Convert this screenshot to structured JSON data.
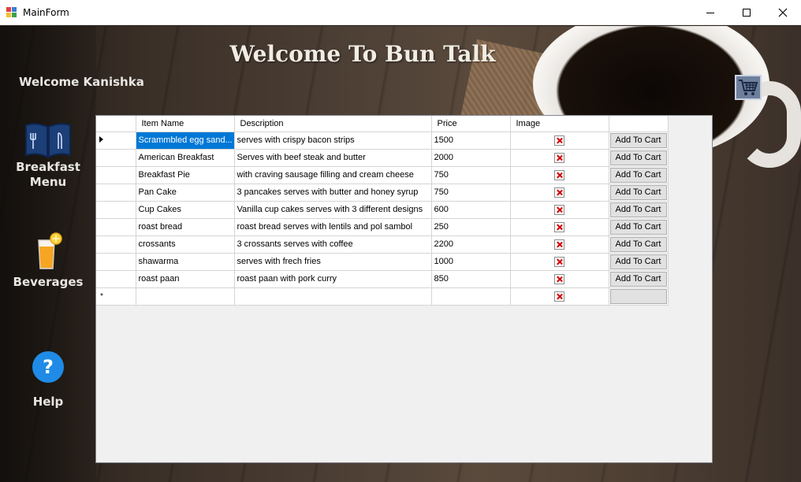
{
  "window": {
    "title": "MainForm"
  },
  "header": {
    "welcome_title": "Welcome To Bun Talk",
    "welcome_user": "Welcome Kanishka"
  },
  "sidebar": {
    "items": [
      {
        "label": "Breakfast\nMenu",
        "icon": "menu-book-icon"
      },
      {
        "label": "Beverages",
        "icon": "juice-glass-icon"
      },
      {
        "label": "Help",
        "icon": "help-icon"
      }
    ]
  },
  "cart": {
    "icon": "shopping-cart-icon"
  },
  "grid": {
    "columns": [
      "Item Name",
      "Description",
      "Price",
      "Image",
      ""
    ],
    "button_label": "Add To Cart",
    "rows": [
      {
        "name": "Scrammbled egg sand...",
        "description": "serves with crispy bacon strips",
        "price": "1500"
      },
      {
        "name": "American Breakfast",
        "description": "Serves with beef steak and butter",
        "price": "2000"
      },
      {
        "name": "Breakfast Pie",
        "description": "with craving sausage filling and cream cheese",
        "price": "750"
      },
      {
        "name": "Pan Cake",
        "description": "3 pancakes serves with butter and honey syrup",
        "price": "750"
      },
      {
        "name": "Cup Cakes",
        "description": "Vanilla cup cakes serves with 3 different designs",
        "price": "600"
      },
      {
        "name": "roast bread",
        "description": "roast bread serves with lentils and pol sambol",
        "price": "250"
      },
      {
        "name": "crossants",
        "description": "3 crossants serves with coffee",
        "price": "2200"
      },
      {
        "name": "shawarma",
        "description": "serves with frech fries",
        "price": "1000"
      },
      {
        "name": "roast paan",
        "description": "roast paan with pork curry",
        "price": "850"
      }
    ],
    "new_row_marker": "*",
    "colors": {
      "selection": "#0078d7"
    }
  }
}
